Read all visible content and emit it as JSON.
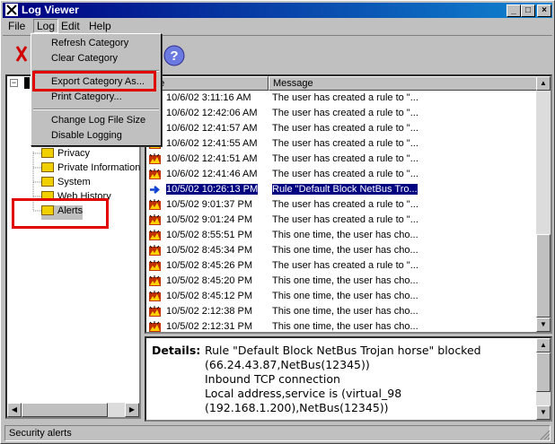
{
  "window": {
    "title": "Log Viewer",
    "min": "_",
    "max": "□",
    "close": "×"
  },
  "menu": {
    "file": "File",
    "log": "Log",
    "edit": "Edit",
    "help": "Help"
  },
  "dropdown": {
    "refresh": "Refresh Category",
    "clear": "Clear Category",
    "export": "Export Category As...",
    "print": "Print Category...",
    "change": "Change Log File Size",
    "disable": "Disable Logging"
  },
  "tree": {
    "items": [
      "Privacy",
      "Private Information",
      "System",
      "Web History",
      "Alerts"
    ]
  },
  "list": {
    "col_date": "ate",
    "col_message": "Message",
    "rows": [
      {
        "date": "10/6/02 3:11:16 AM",
        "message": "The user has created a rule to \"..."
      },
      {
        "date": "10/6/02 12:42:06 AM",
        "message": "The user has created a rule to \"..."
      },
      {
        "date": "10/6/02 12:41:57 AM",
        "message": "The user has created a rule to \"..."
      },
      {
        "date": "10/6/02 12:41:55 AM",
        "message": "The user has created a rule to \"..."
      },
      {
        "date": "10/6/02 12:41:51 AM",
        "message": "The user has created a rule to \"..."
      },
      {
        "date": "10/6/02 12:41:46 AM",
        "message": "The user has created a rule to \"..."
      },
      {
        "date": "10/5/02 10:26:13 PM",
        "message": "Rule \"Default Block NetBus Tro...",
        "selected": true
      },
      {
        "date": "10/5/02 9:01:37 PM",
        "message": "The user has created a rule to \"..."
      },
      {
        "date": "10/5/02 9:01:24 PM",
        "message": "The user has created a rule to \"..."
      },
      {
        "date": "10/5/02 8:55:51 PM",
        "message": "This one time, the user has cho..."
      },
      {
        "date": "10/5/02 8:45:34 PM",
        "message": "This one time, the user has cho..."
      },
      {
        "date": "10/5/02 8:45:26 PM",
        "message": "The user has created a rule to \"..."
      },
      {
        "date": "10/5/02 8:45:20 PM",
        "message": "This one time, the user has cho..."
      },
      {
        "date": "10/5/02 8:45:12 PM",
        "message": "This one time, the user has cho..."
      },
      {
        "date": "10/5/02 2:12:38 PM",
        "message": "This one time, the user has cho..."
      },
      {
        "date": "10/5/02 2:12:31 PM",
        "message": "This one time, the user has cho..."
      }
    ]
  },
  "details": {
    "label": "Details:",
    "lines": [
      "Rule \"Default Block NetBus Trojan horse\" blocked",
      "(66.24.43.87,NetBus(12345))",
      "Inbound TCP connection",
      "Local address,service is (virtual_98",
      "(192.168.1.200),NetBus(12345))"
    ]
  },
  "status": {
    "text": "Security alerts"
  },
  "colors": {
    "title_start": "#000080",
    "title_end": "#1084d0",
    "highlight": "#e00000",
    "selection": "#000080"
  }
}
